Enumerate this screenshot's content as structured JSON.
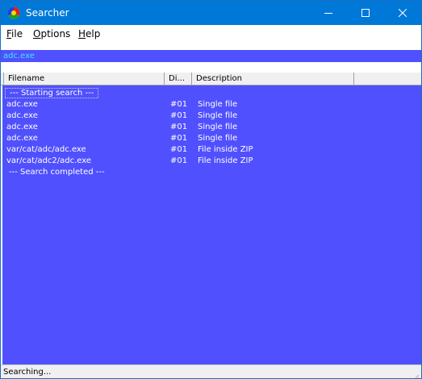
{
  "window": {
    "title": "Searcher"
  },
  "menu": [
    {
      "key": "F",
      "rest": "ile"
    },
    {
      "key": "O",
      "rest": "ptions"
    },
    {
      "key": "H",
      "rest": "elp"
    }
  ],
  "search": {
    "query": "adc.exe"
  },
  "list": {
    "columns": [
      "Filename",
      "Di...",
      "Description"
    ],
    "start_marker": "--- Starting search ---",
    "rows": [
      {
        "filename": "adc.exe",
        "disk": "#01",
        "description": "Single file"
      },
      {
        "filename": "adc.exe",
        "disk": "#01",
        "description": "Single file"
      },
      {
        "filename": "adc.exe",
        "disk": "#01",
        "description": "Single file"
      },
      {
        "filename": "adc.exe",
        "disk": "#01",
        "description": "Single file"
      },
      {
        "filename": "var/cat/adc/adc.exe",
        "disk": "#01",
        "description": "File inside ZIP"
      },
      {
        "filename": "var/cat/adc2/adc.exe",
        "disk": "#01",
        "description": "File inside ZIP"
      }
    ],
    "end_marker": "--- Search completed ---"
  },
  "status": {
    "text": "Searching..."
  },
  "colors": {
    "titlebar": "#0078d7",
    "list_background": "#5050ff",
    "search_text": "#40e8ff"
  },
  "icons": {
    "app": "color-wheel-icon",
    "minimize": "minimize-icon",
    "maximize": "maximize-icon",
    "close": "close-icon"
  }
}
